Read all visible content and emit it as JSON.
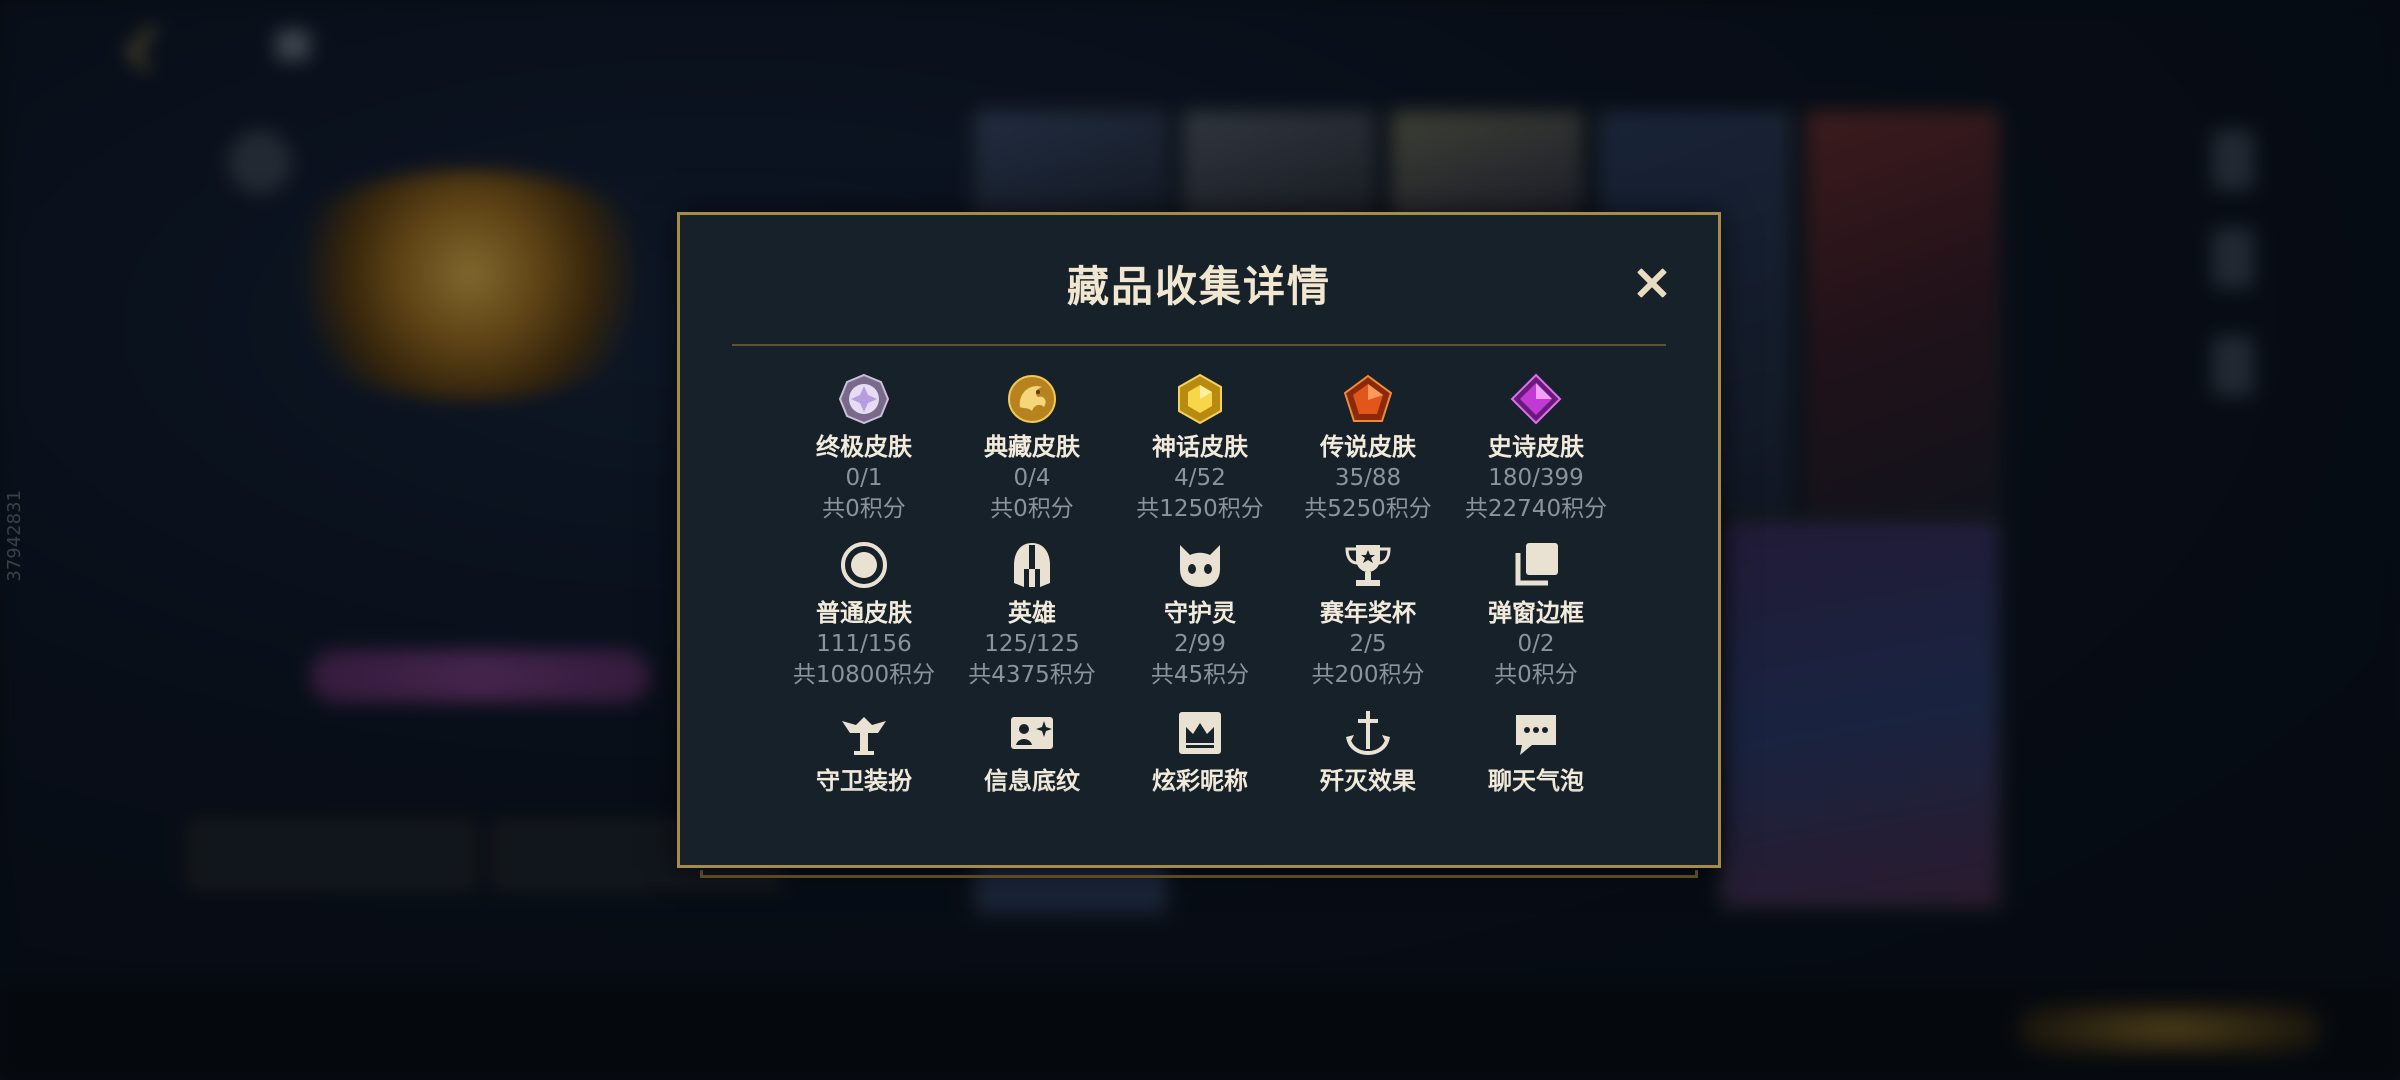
{
  "modal": {
    "title": "藏品收集详情",
    "close_label": ""
  },
  "items": [
    {
      "name": "终极皮肤",
      "count": "0/1",
      "points": "共0积分",
      "icon": "ultimate-gem-icon"
    },
    {
      "name": "典藏皮肤",
      "count": "0/4",
      "points": "共0积分",
      "icon": "dragon-emblem-icon"
    },
    {
      "name": "神话皮肤",
      "count": "4/52",
      "points": "共1250积分",
      "icon": "mythic-gem-icon"
    },
    {
      "name": "传说皮肤",
      "count": "35/88",
      "points": "共5250积分",
      "icon": "legendary-gem-icon"
    },
    {
      "name": "史诗皮肤",
      "count": "180/399",
      "points": "共22740积分",
      "icon": "epic-gem-icon"
    },
    {
      "name": "普通皮肤",
      "count": "111/156",
      "points": "共10800积分",
      "icon": "circle-icon"
    },
    {
      "name": "英雄",
      "count": "125/125",
      "points": "共4375积分",
      "icon": "helmet-icon"
    },
    {
      "name": "守护灵",
      "count": "2/99",
      "points": "共45积分",
      "icon": "guardian-creature-icon"
    },
    {
      "name": "赛年奖杯",
      "count": "2/5",
      "points": "共200积分",
      "icon": "trophy-icon"
    },
    {
      "name": "弹窗边框",
      "count": "0/2",
      "points": "共0积分",
      "icon": "frame-stack-icon"
    },
    {
      "name": "守卫装扮",
      "count": "",
      "points": "",
      "icon": "ward-icon"
    },
    {
      "name": "信息底纹",
      "count": "",
      "points": "",
      "icon": "card-sparkle-icon"
    },
    {
      "name": "炫彩昵称",
      "count": "",
      "points": "",
      "icon": "crown-name-icon"
    },
    {
      "name": "歼灭效果",
      "count": "",
      "points": "",
      "icon": "anchor-sword-icon"
    },
    {
      "name": "聊天气泡",
      "count": "",
      "points": "",
      "icon": "chat-bubble-icon"
    }
  ],
  "side_id": "37942831",
  "colors": {
    "modal_bg": "#172129",
    "modal_border": "#a88a4a",
    "title_text": "#f1e7d0",
    "label_text": "#f2ebdc",
    "sub_text": "#8b939c",
    "gold": "#c9a24a"
  }
}
